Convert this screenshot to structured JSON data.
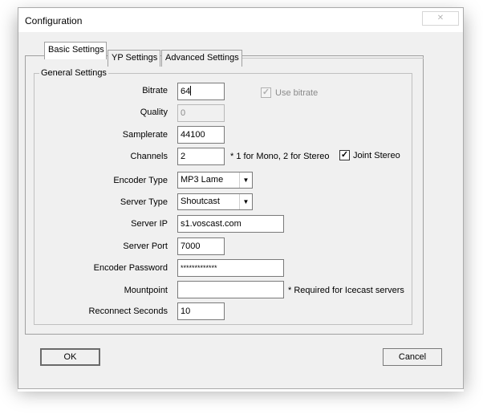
{
  "window": {
    "title": "Configuration",
    "close_glyph": "✕"
  },
  "tabs": [
    {
      "label": "Basic Settings",
      "active": true
    },
    {
      "label": "YP Settings",
      "active": false
    },
    {
      "label": "Advanced Settings",
      "active": false
    }
  ],
  "group": {
    "label": "General Settings"
  },
  "fields": {
    "bitrate": {
      "label": "Bitrate",
      "value": "64"
    },
    "quality": {
      "label": "Quality",
      "value": "0"
    },
    "samplerate": {
      "label": "Samplerate",
      "value": "44100"
    },
    "channels": {
      "label": "Channels",
      "value": "2",
      "note": "* 1 for Mono, 2 for Stereo"
    },
    "encoder_type": {
      "label": "Encoder Type",
      "value": "MP3 Lame"
    },
    "server_type": {
      "label": "Server Type",
      "value": "Shoutcast"
    },
    "server_ip": {
      "label": "Server IP",
      "value": "s1.voscast.com"
    },
    "server_port": {
      "label": "Server Port",
      "value": "7000"
    },
    "encoder_password": {
      "label": "Encoder Password",
      "value": "*************"
    },
    "mountpoint": {
      "label": "Mountpoint",
      "value": "",
      "note": "* Required for Icecast servers"
    },
    "reconnect_seconds": {
      "label": "Reconnect Seconds",
      "value": "10"
    }
  },
  "checkboxes": {
    "use_bitrate": {
      "label": "Use bitrate",
      "checked": true,
      "enabled": false
    },
    "joint_stereo": {
      "label": "Joint Stereo",
      "checked": true,
      "enabled": true
    }
  },
  "buttons": {
    "ok": "OK",
    "cancel": "Cancel"
  },
  "icons": {
    "combo_arrow": "▼",
    "check": "✓"
  }
}
